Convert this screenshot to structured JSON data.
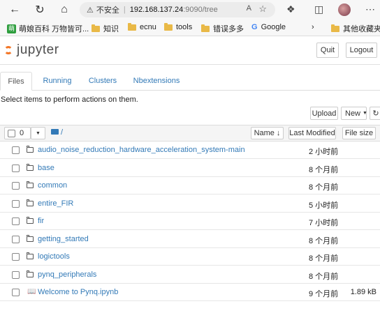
{
  "browser": {
    "security_label": "不安全",
    "url_host": "192.168.137.24",
    "url_rest": ":9090/tree",
    "read_aloud": "A",
    "bookmarks": [
      {
        "label": "萌娘百科 万物皆可...",
        "icon": "moegirl-icon"
      },
      {
        "label": "知识",
        "icon": "folder-icon"
      },
      {
        "label": "ecnu",
        "icon": "folder-icon"
      },
      {
        "label": "tools",
        "icon": "folder-icon"
      },
      {
        "label": "错误多多",
        "icon": "folder-icon"
      },
      {
        "label": "Google",
        "icon": "google-icon"
      },
      {
        "label": "其他收藏夹",
        "icon": "folder-icon"
      }
    ]
  },
  "header": {
    "logo_text": "jupyter",
    "quit_label": "Quit",
    "logout_label": "Logout"
  },
  "tabs": [
    {
      "label": "Files",
      "active": true
    },
    {
      "label": "Running",
      "active": false
    },
    {
      "label": "Clusters",
      "active": false
    },
    {
      "label": "Nbextensions",
      "active": false
    }
  ],
  "hint": "Select items to perform actions on them.",
  "toolbar": {
    "upload_label": "Upload",
    "new_label": "New",
    "refresh_icon": "refresh-icon"
  },
  "list_header": {
    "selected_count": "0",
    "path": "/",
    "name_col": "Name",
    "modified_col": "Last Modified",
    "size_col": "File size"
  },
  "files": [
    {
      "name": "audio_noise_reduction_hardware_acceleration_system-main",
      "modified": "2 小时前",
      "size": "",
      "type": "folder"
    },
    {
      "name": "base",
      "modified": "8 个月前",
      "size": "",
      "type": "folder"
    },
    {
      "name": "common",
      "modified": "8 个月前",
      "size": "",
      "type": "folder"
    },
    {
      "name": "entire_FIR",
      "modified": "5 小时前",
      "size": "",
      "type": "folder"
    },
    {
      "name": "fir",
      "modified": "7 小时前",
      "size": "",
      "type": "folder"
    },
    {
      "name": "getting_started",
      "modified": "8 个月前",
      "size": "",
      "type": "folder"
    },
    {
      "name": "logictools",
      "modified": "8 个月前",
      "size": "",
      "type": "folder"
    },
    {
      "name": "pynq_peripherals",
      "modified": "8 个月前",
      "size": "",
      "type": "folder"
    },
    {
      "name": "Welcome to Pynq.ipynb",
      "modified": "9 个月前",
      "size": "1.89 kB",
      "type": "notebook"
    }
  ]
}
